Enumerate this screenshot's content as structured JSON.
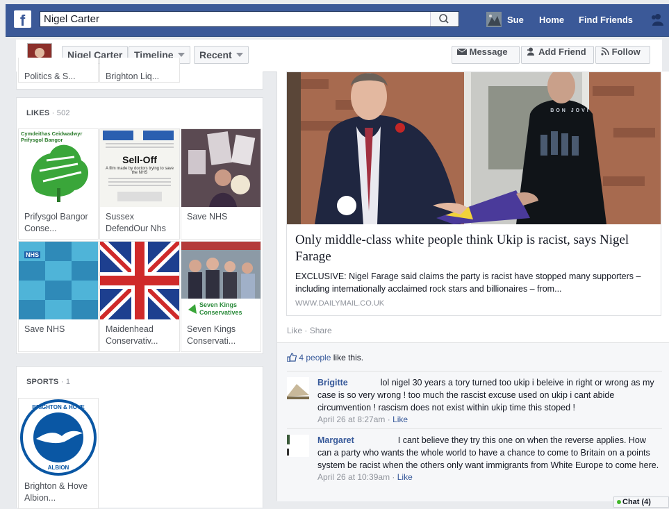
{
  "nav": {
    "logo": "f",
    "search_value": "Nigel Carter",
    "user_name": "Sue",
    "home_label": "Home",
    "find_friends_label": "Find Friends"
  },
  "profile": {
    "name": "Nigel Carter",
    "timeline_label": "Timeline",
    "recent_label": "Recent",
    "message_label": "Message",
    "add_friend_label": "Add Friend",
    "follow_label": "Follow"
  },
  "top_partial_tiles": [
    "Politics & S...",
    "Brighton Liq..."
  ],
  "likes": {
    "title": "LIKES",
    "count": "· 502",
    "items": [
      {
        "label": "Prifysgol Bangor Conse...",
        "image_text": "Cymdeithas Ceidwadwyr Prifysgol Bangor"
      },
      {
        "label": "Sussex DefendOur Nhs",
        "image_text": "Sell-Off",
        "image_sub": "A film made by doctors trying to save the NHS"
      },
      {
        "label": "Save NHS"
      },
      {
        "label": "Save NHS",
        "image_text": "NHS"
      },
      {
        "label": "Maidenhead Conservativ..."
      },
      {
        "label": "Seven Kings Conservati...",
        "image_text": "Seven Kings Conservatives"
      }
    ]
  },
  "sports": {
    "title": "SPORTS",
    "count": "· 1",
    "items": [
      {
        "label": "Brighton & Hove Albion...",
        "badge_top": "BRIGHTON & HOVE",
        "badge_bottom": "ALBION"
      }
    ]
  },
  "post": {
    "link_title": "Only middle-class white people think Ukip is racist, says Nigel Farage",
    "link_description": "EXCLUSIVE: Nigel Farage said claims the party is racist have stopped many supporters – including internationally acclaimed rock stars and billionaires – from...",
    "link_source": "WWW.DAILYMAIL.CO.UK",
    "shirt_text": "BON JOVI",
    "like_action": "Like",
    "share_action": "Share",
    "likes_count_text": "4 people",
    "likes_suffix": "like this.",
    "comments": [
      {
        "name": "Brigitte",
        "text": "lol nigel 30 years a tory turned too ukip i beleive in right or wrong as my case is so very wrong ! too much the rascist excuse used on ukip i cant abide circumvention ! rascism does not exist within ukip time this stoped !",
        "time": "April 26 at 8:27am",
        "like": "Like"
      },
      {
        "name": "Margaret",
        "text": "I cant believe they try this one on when the reverse applies. How can a party who wants the whole world to have a chance to come to Britain on a points system be racist when the others only want immigrants from White Europe to come here.",
        "time": "April 26 at 10:39am",
        "like": "Like"
      }
    ]
  },
  "chat": {
    "label": "Chat (4)"
  },
  "colors": {
    "brand_blue": "#3b5998",
    "link_blue": "#365899",
    "background": "#e9ebee"
  },
  "icons": [
    "facebook-logo-icon",
    "search-icon",
    "friend-requests-icon",
    "message-icon",
    "add-friend-icon",
    "follow-icon",
    "thumbs-up-icon",
    "online-dot-icon"
  ]
}
